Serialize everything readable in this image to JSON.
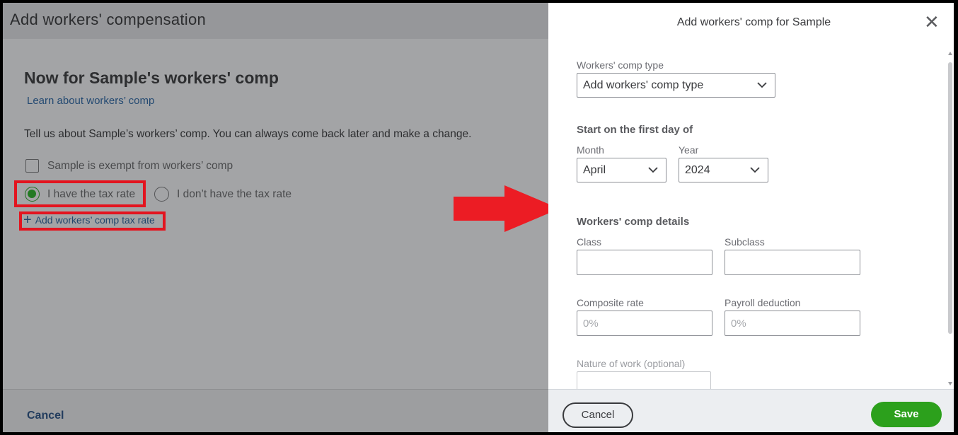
{
  "background": {
    "header_title": "Add workers' compensation",
    "heading": "Now for Sample's workers' comp",
    "learn_link": "Learn about workers’ comp",
    "description": "Tell us about Sample’s workers’ comp. You can always come back later and make a change.",
    "exempt_label": "Sample is exempt from workers’ comp",
    "have_rate_label": "I have the tax rate",
    "no_rate_label": "I don’t have the tax rate",
    "selected_option": "I have the tax rate",
    "add_rate_link": "Add workers’ comp tax rate",
    "cancel_label": "Cancel"
  },
  "panel": {
    "title": "Add workers' comp for Sample",
    "close_icon": "close-icon",
    "comp_type": {
      "label": "Workers' comp type",
      "value": "Add workers' comp type"
    },
    "start_section": "Start on the first day of",
    "month": {
      "label": "Month",
      "value": "April"
    },
    "year": {
      "label": "Year",
      "value": "2024"
    },
    "details_section": "Workers' comp details",
    "class": {
      "label": "Class",
      "value": ""
    },
    "subclass": {
      "label": "Subclass",
      "value": ""
    },
    "composite_rate": {
      "label": "Composite rate",
      "placeholder": "0%"
    },
    "payroll_deduction": {
      "label": "Payroll deduction",
      "placeholder": "0%"
    },
    "nature_of_work": {
      "label": "Nature of work (optional)",
      "value": ""
    },
    "footer": {
      "cancel_label": "Cancel",
      "save_label": "Save"
    }
  },
  "colors": {
    "highlight_red": "#e3141f",
    "save_green": "#2ca01c",
    "link_blue": "#23466b"
  }
}
